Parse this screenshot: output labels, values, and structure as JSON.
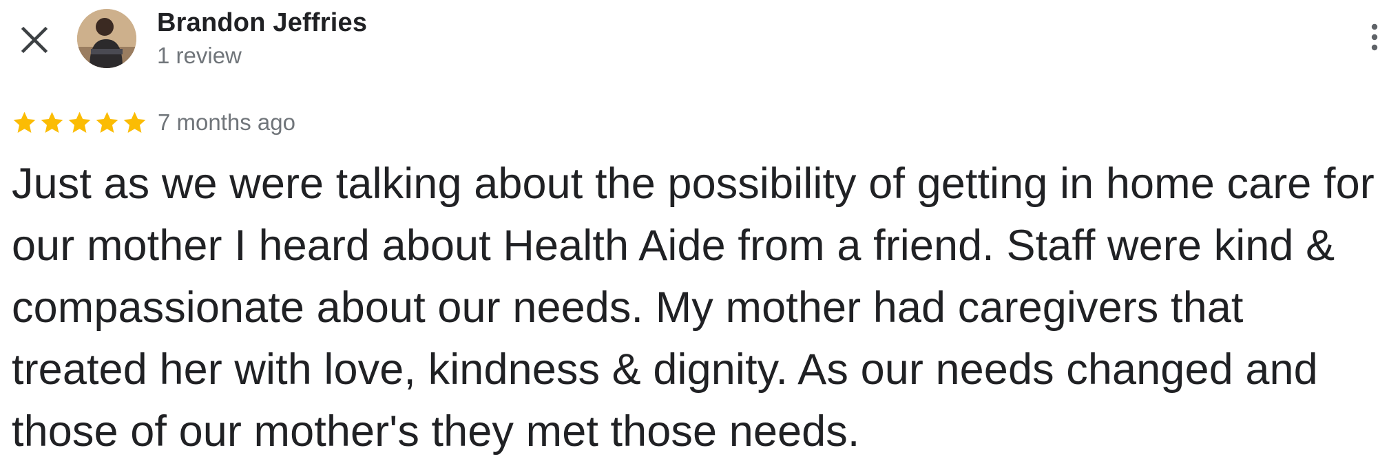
{
  "reviewer": {
    "name": "Brandon Jeffries",
    "review_count": "1 review"
  },
  "rating": {
    "stars": 5,
    "max_stars": 5,
    "star_color": "#fbbc04",
    "time_ago": "7 months ago"
  },
  "review": {
    "text": "Just as we were talking about the possibility of getting in home care for our mother I heard about Health Aide from a friend. Staff were kind & compassionate about our needs. My mother had caregivers that treated her with love, kindness & dignity. As our needs changed and those of our mother's they met those needs."
  },
  "icons": {
    "close": "close-icon",
    "more": "more-vert-icon",
    "star": "star-icon"
  },
  "colors": {
    "text_primary": "#202124",
    "text_secondary": "#70757a"
  }
}
